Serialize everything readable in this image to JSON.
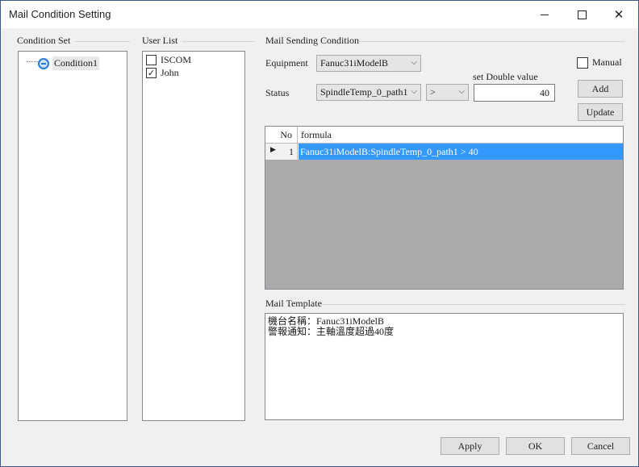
{
  "window": {
    "title": "Mail Condition Setting",
    "minimize_glyph": "—",
    "maximize_glyph": "☐",
    "close_glyph": "✕"
  },
  "condition_set": {
    "title": "Condition Set",
    "nodes": [
      {
        "label": "Condition1",
        "icon": "condition-node-icon"
      }
    ]
  },
  "user_list": {
    "title": "User List",
    "users": [
      {
        "label": "ISCOM",
        "checked": false
      },
      {
        "label": "John",
        "checked": true
      }
    ]
  },
  "mail_sending_condition": {
    "title": "Mail Sending Condition",
    "equipment_label": "Equipment",
    "equipment_value": "Fanuc31iModelB",
    "status_label": "Status",
    "status_value": "SpindleTemp_0_path1",
    "operator_value": ">",
    "set_value_label": "set Double value",
    "set_value": "40",
    "manual_label": "Manual",
    "manual_checked": false,
    "add_button": "Add",
    "update_button": "Update",
    "grid": {
      "columns": [
        "No",
        "formula"
      ],
      "rows": [
        {
          "no": "1",
          "formula": "Fanuc31iModelB:SpindleTemp_0_path1 > 40",
          "selected": true
        }
      ]
    }
  },
  "mail_template": {
    "title": "Mail Template",
    "content": "機台名稱：Fanuc31iModelB\n警報通知：主軸溫度超過40度"
  },
  "footer": {
    "apply_button": "Apply",
    "ok_button": "OK",
    "cancel_button": "Cancel"
  },
  "colors": {
    "selection": "#3399ff",
    "grid_background": "#ababab",
    "tree_icon": "#2a7ad8"
  }
}
